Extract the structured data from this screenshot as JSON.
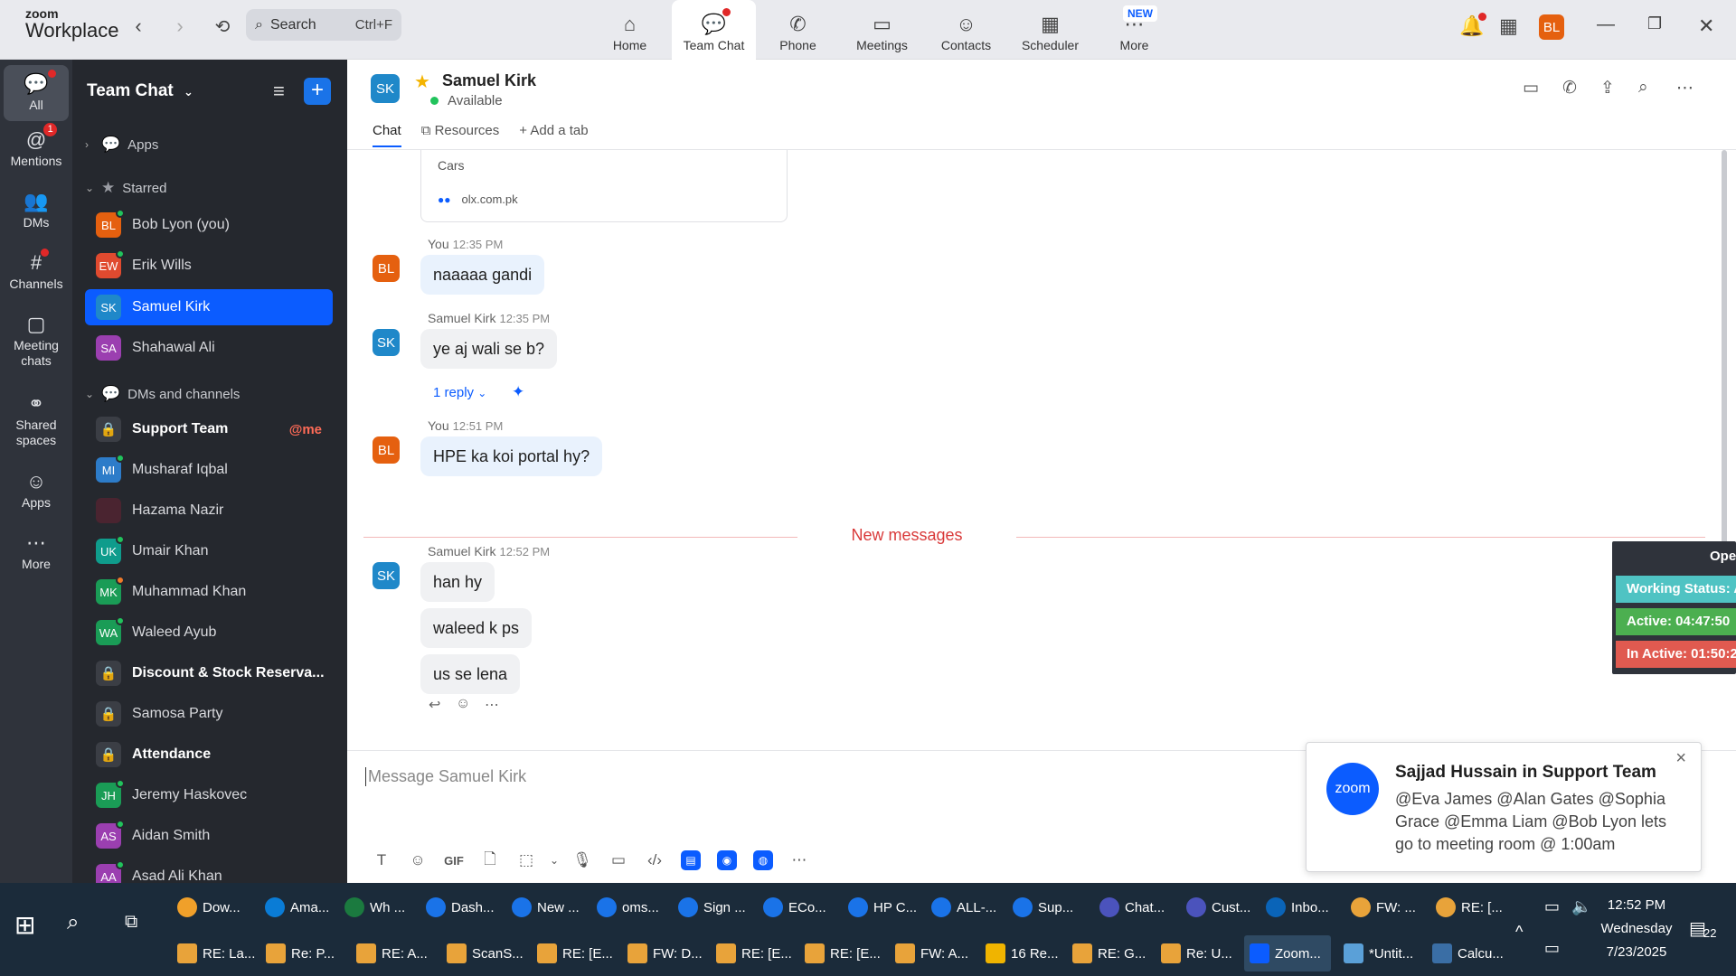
{
  "app": {
    "brand_top": "zoom",
    "brand_bottom": "Workplace"
  },
  "search": {
    "label": "Search",
    "shortcut": "Ctrl+F"
  },
  "nav_tabs": [
    {
      "label": "Home",
      "icon": "home-icon"
    },
    {
      "label": "Team Chat",
      "icon": "team-chat-icon"
    },
    {
      "label": "Phone",
      "icon": "phone-icon"
    },
    {
      "label": "Meetings",
      "icon": "meetings-icon"
    },
    {
      "label": "Contacts",
      "icon": "contacts-icon"
    },
    {
      "label": "Scheduler",
      "icon": "scheduler-icon"
    },
    {
      "label": "More",
      "icon": "more-icon",
      "badge": "NEW"
    }
  ],
  "user_avatar": "BL",
  "rail": [
    {
      "label": "All"
    },
    {
      "label": "Mentions",
      "badge": "1"
    },
    {
      "label": "DMs"
    },
    {
      "label": "Channels"
    },
    {
      "label": "Meeting chats"
    },
    {
      "label": "Shared spaces"
    },
    {
      "label": "Apps"
    },
    {
      "label": "More"
    }
  ],
  "sidebar": {
    "title": "Team Chat",
    "sections": {
      "apps": "Apps",
      "starred": "Starred",
      "dms": "DMs and channels"
    },
    "starred": [
      {
        "initials": "BL",
        "name": "Bob Lyon (you)",
        "color": "#e5600f"
      },
      {
        "initials": "EW",
        "name": "Erik Wills",
        "color": "#e04a2f"
      },
      {
        "initials": "SK",
        "name": "Samuel Kirk",
        "color": "#1f88c9"
      },
      {
        "initials": "SA",
        "name": "Shahawal Ali",
        "color": "#9b3fb0"
      }
    ],
    "dms": [
      {
        "initials": "",
        "name": "Support Team",
        "tag": "@me"
      },
      {
        "initials": "MI",
        "name": "Musharaf Iqbal",
        "color": "#2d7cc9"
      },
      {
        "initials": "",
        "name": "Hazama Nazir",
        "color": "#4a2430"
      },
      {
        "initials": "UK",
        "name": "Umair Khan",
        "color": "#0f9c8c"
      },
      {
        "initials": "MK",
        "name": "Muhammad Khan",
        "color": "#1a9c56"
      },
      {
        "initials": "WA",
        "name": "Waleed Ayub",
        "color": "#1a9c56"
      },
      {
        "initials": "",
        "name": "Discount & Stock Reserva..."
      },
      {
        "initials": "",
        "name": "Samosa Party"
      },
      {
        "initials": "",
        "name": "Attendance"
      },
      {
        "initials": "JH",
        "name": "Jeremy Haskovec",
        "color": "#1a9c56"
      },
      {
        "initials": "AS",
        "name": "Aidan Smith",
        "color": "#9b3fb0"
      },
      {
        "initials": "AA",
        "name": "Asad Ali Khan",
        "color": "#9b3fb0"
      }
    ]
  },
  "chat": {
    "avatar": "SK",
    "name": "Samuel Kirk",
    "status": "Available",
    "tabs": [
      "Chat",
      "Resources",
      "Add a tab"
    ]
  },
  "messages": {
    "preview": {
      "title": "Cars",
      "link": "olx.com.pk"
    },
    "m1": {
      "sender": "You",
      "time": "12:35 PM",
      "avatar": "BL",
      "text": "naaaaa gandi"
    },
    "m2": {
      "sender": "Samuel Kirk",
      "time": "12:35 PM",
      "avatar": "SK",
      "text": "ye aj wali se b?",
      "reply": "1 reply"
    },
    "m3": {
      "sender": "You",
      "time": "12:51 PM",
      "avatar": "BL",
      "text": "HPE ka koi portal hy?"
    },
    "divider": "New messages",
    "m4": {
      "sender": "Samuel Kirk",
      "time": "12:52 PM",
      "avatar": "SK",
      "lines": [
        "han hy",
        "waleed k ps",
        "us se lena"
      ]
    }
  },
  "composer": {
    "placeholder": "Message Samuel Kirk",
    "gif": "GIF"
  },
  "widget": {
    "title": "Ope",
    "working": "Working Status: A",
    "active": "Active: 04:47:50",
    "inactive": "In Active: 01:50:2",
    "colors": {
      "working": "#4fc3c3",
      "active": "#4caf50",
      "inactive": "#e05a50"
    }
  },
  "toast": {
    "logo": "zoom",
    "title": "Sajjad Hussain in Support Team",
    "body": "@Eva James @Alan Gates @Sophia Grace @Emma Liam @Bob Lyon lets go to meeting room @ 1:00am"
  },
  "taskbar": {
    "row1": [
      "Dow...",
      "Ama...",
      "Wh ...",
      "Dash...",
      "New ...",
      "oms...",
      "Sign ...",
      "ECo...",
      "HP C...",
      "ALL-...",
      "Sup...",
      "Chat...",
      "Cust...",
      "Inbo...",
      "FW: ...",
      "RE: [..."
    ],
    "row2": [
      "RE: La...",
      "Re: P...",
      "RE: A...",
      "ScanS...",
      "RE: [E...",
      "FW: D...",
      "RE: [E...",
      "RE: [E...",
      "FW: A...",
      "16 Re...",
      "RE: G...",
      "Re: U...",
      "Zoom...",
      "*Untit...",
      "Calcu..."
    ],
    "time": "12:52 PM",
    "day": "Wednesday",
    "date": "7/23/2025",
    "notif_count": "22"
  }
}
